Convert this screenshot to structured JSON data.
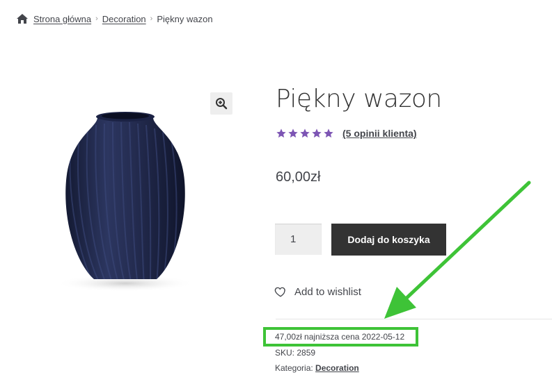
{
  "breadcrumb": {
    "home_icon": "home-icon",
    "items": [
      "Strona główna",
      "Decoration",
      "Piękny wazon"
    ],
    "separator": "›"
  },
  "product": {
    "title": "Piękny wazon",
    "rating": {
      "stars": 5,
      "reviews_label": "(5 opinii klienta)",
      "star_color": "#7d55b4"
    },
    "price": "60,00zł",
    "quantity": "1",
    "add_to_cart_label": "Dodaj do koszyka",
    "wishlist_label": "Add to wishlist",
    "lowest_price_note": "47,00zł najniższa cena 2022-05-12",
    "sku_label": "SKU:",
    "sku_value": "2859",
    "category_label": "Kategoria:",
    "category_value": "Decoration",
    "image_icon": "zoom-in-icon"
  },
  "annotation": {
    "highlight_color": "#3ec337",
    "arrow_icon": "arrow-icon"
  }
}
